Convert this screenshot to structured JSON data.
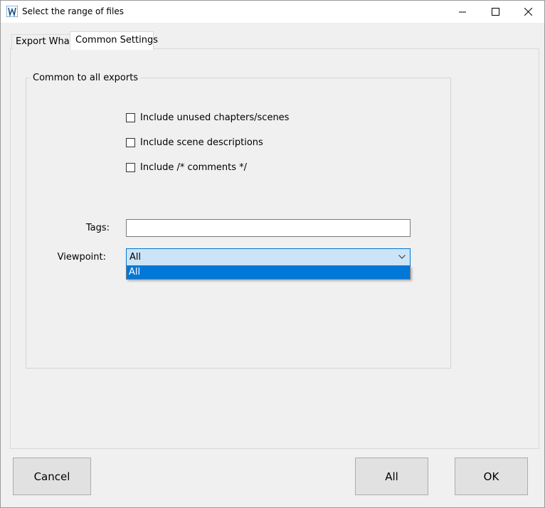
{
  "window": {
    "title": "Select the range of files",
    "app_icon": "wv-app-icon"
  },
  "caption_buttons": {
    "minimize_icon": "minimize-icon",
    "maximize_icon": "maximize-icon",
    "close_icon": "close-icon"
  },
  "tabs": [
    {
      "label": "Export What",
      "selected": false
    },
    {
      "label": "Common Settings",
      "selected": true
    }
  ],
  "group": {
    "title": "Common to all exports",
    "checkboxes": [
      {
        "label": "Include unused chapters/scenes",
        "checked": false
      },
      {
        "label": "Include scene descriptions",
        "checked": false
      },
      {
        "label": "Include /* comments */",
        "checked": false
      }
    ],
    "tags_label": "Tags:",
    "tags_value": "",
    "viewpoint_label": "Viewpoint:",
    "viewpoint_value": "All",
    "viewpoint_options": [
      "All"
    ]
  },
  "buttons": {
    "cancel": "Cancel",
    "all": "All",
    "ok": "OK"
  },
  "colors": {
    "accent": "#0078d7",
    "combo_bg": "#cce4f7",
    "window_bg": "#f0f0f0"
  }
}
